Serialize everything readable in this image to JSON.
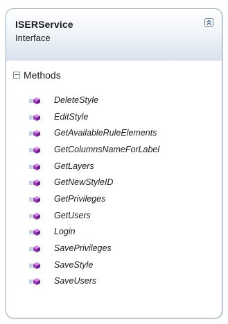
{
  "class_box": {
    "title": "ISERService",
    "stereotype": "Interface",
    "collapse_icon": "double-chevron-up-icon",
    "border_color": "#9aa6b2",
    "header_gradient": [
      "#ffffff",
      "#d9e2ee"
    ]
  },
  "methods_section": {
    "label": "Methods",
    "expanded": true,
    "method_icon": "method-purple-cube-icon",
    "icon_color": "#9b3fb4",
    "items": [
      {
        "name": "DeleteStyle"
      },
      {
        "name": "EditStyle"
      },
      {
        "name": "GetAvailableRuleElements"
      },
      {
        "name": "GetColumnsNameForLabel"
      },
      {
        "name": "GetLayers"
      },
      {
        "name": "GetNewStyleID"
      },
      {
        "name": "GetPrivileges"
      },
      {
        "name": "GetUsers"
      },
      {
        "name": "Login"
      },
      {
        "name": "SavePrivileges"
      },
      {
        "name": "SaveStyle"
      },
      {
        "name": "SaveUsers"
      }
    ]
  }
}
